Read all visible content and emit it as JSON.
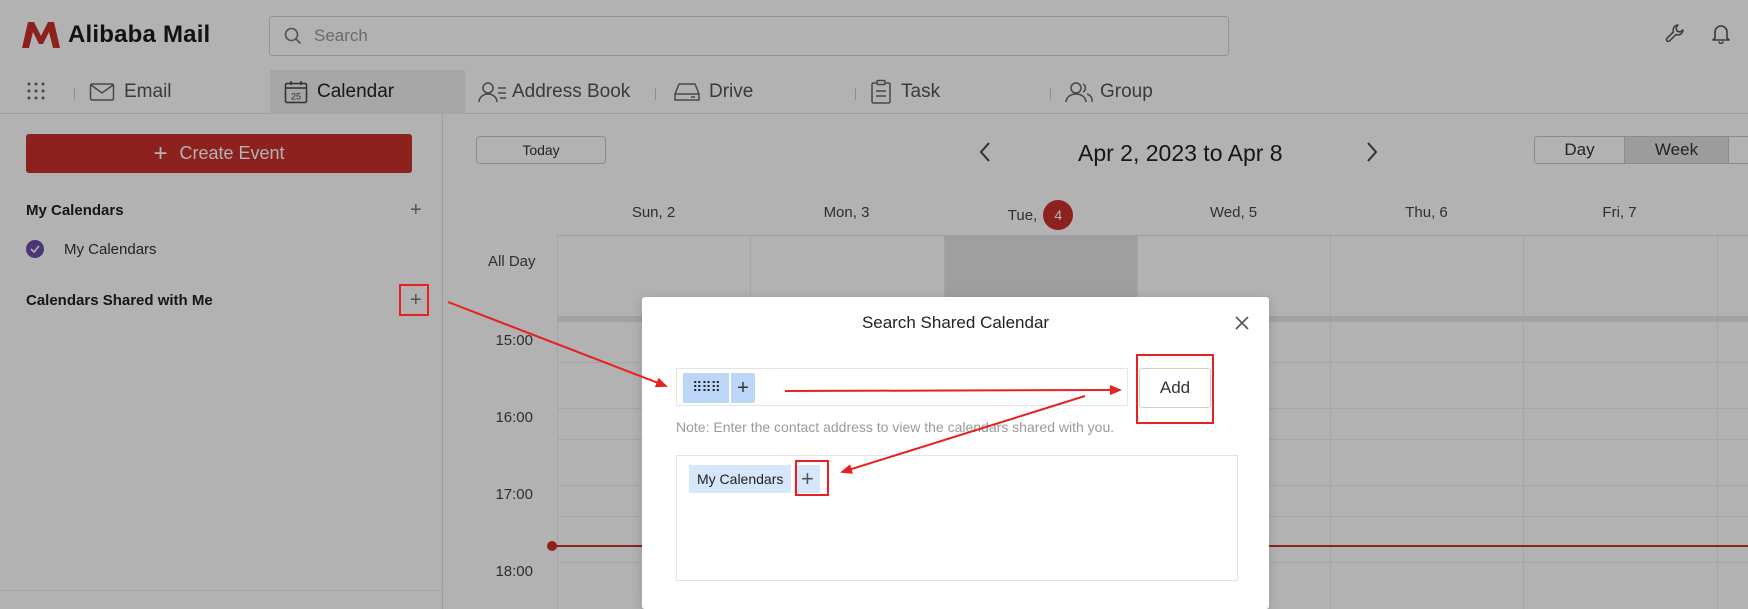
{
  "app": {
    "logo_text": "Alibaba Mail",
    "brand_color": "#c9302c",
    "search_placeholder": "Search",
    "top_icons": [
      "wrench-icon",
      "bell-icon"
    ]
  },
  "nav": {
    "tabs": [
      {
        "label": "Email",
        "icon": "mail-icon",
        "active": false
      },
      {
        "label": "Calendar",
        "icon": "calendar-icon",
        "icon_text": "25",
        "active": true
      },
      {
        "label": "Address Book",
        "icon": "contacts-icon",
        "active": false
      },
      {
        "label": "Drive",
        "icon": "drive-icon",
        "active": false
      },
      {
        "label": "Task",
        "icon": "clipboard-icon",
        "active": false
      },
      {
        "label": "Group",
        "icon": "group-icon",
        "active": false
      }
    ]
  },
  "sidebar": {
    "create_event": "Create Event",
    "my_calendars_title": "My Calendars",
    "my_calendars_items": [
      {
        "label": "My Calendars",
        "checked": true,
        "color": "#6a4fa8"
      }
    ],
    "shared_title": "Calendars Shared with Me"
  },
  "calendar": {
    "today_label": "Today",
    "date_range": "Apr 2, 2023 to Apr 8",
    "views": {
      "day": "Day",
      "week": "Week",
      "active": "Week"
    },
    "days": [
      {
        "label": "Sun, 2"
      },
      {
        "label": "Mon, 3"
      },
      {
        "label": "Tue,",
        "badge": "4",
        "today": true
      },
      {
        "label": "Wed, 5"
      },
      {
        "label": "Thu, 6"
      },
      {
        "label": "Fri, 7"
      }
    ],
    "all_day_label": "All Day",
    "times": [
      "15:00",
      "16:00",
      "17:00",
      "18:00"
    ]
  },
  "dialog": {
    "title": "Search Shared Calendar",
    "contact_chip_label": "⠿⠿⠿",
    "add_button": "Add",
    "note": "Note: Enter the contact address to view the calendars shared with you.",
    "results": [
      {
        "label": "My Calendars"
      }
    ]
  },
  "annotation_color": "#e8211f"
}
